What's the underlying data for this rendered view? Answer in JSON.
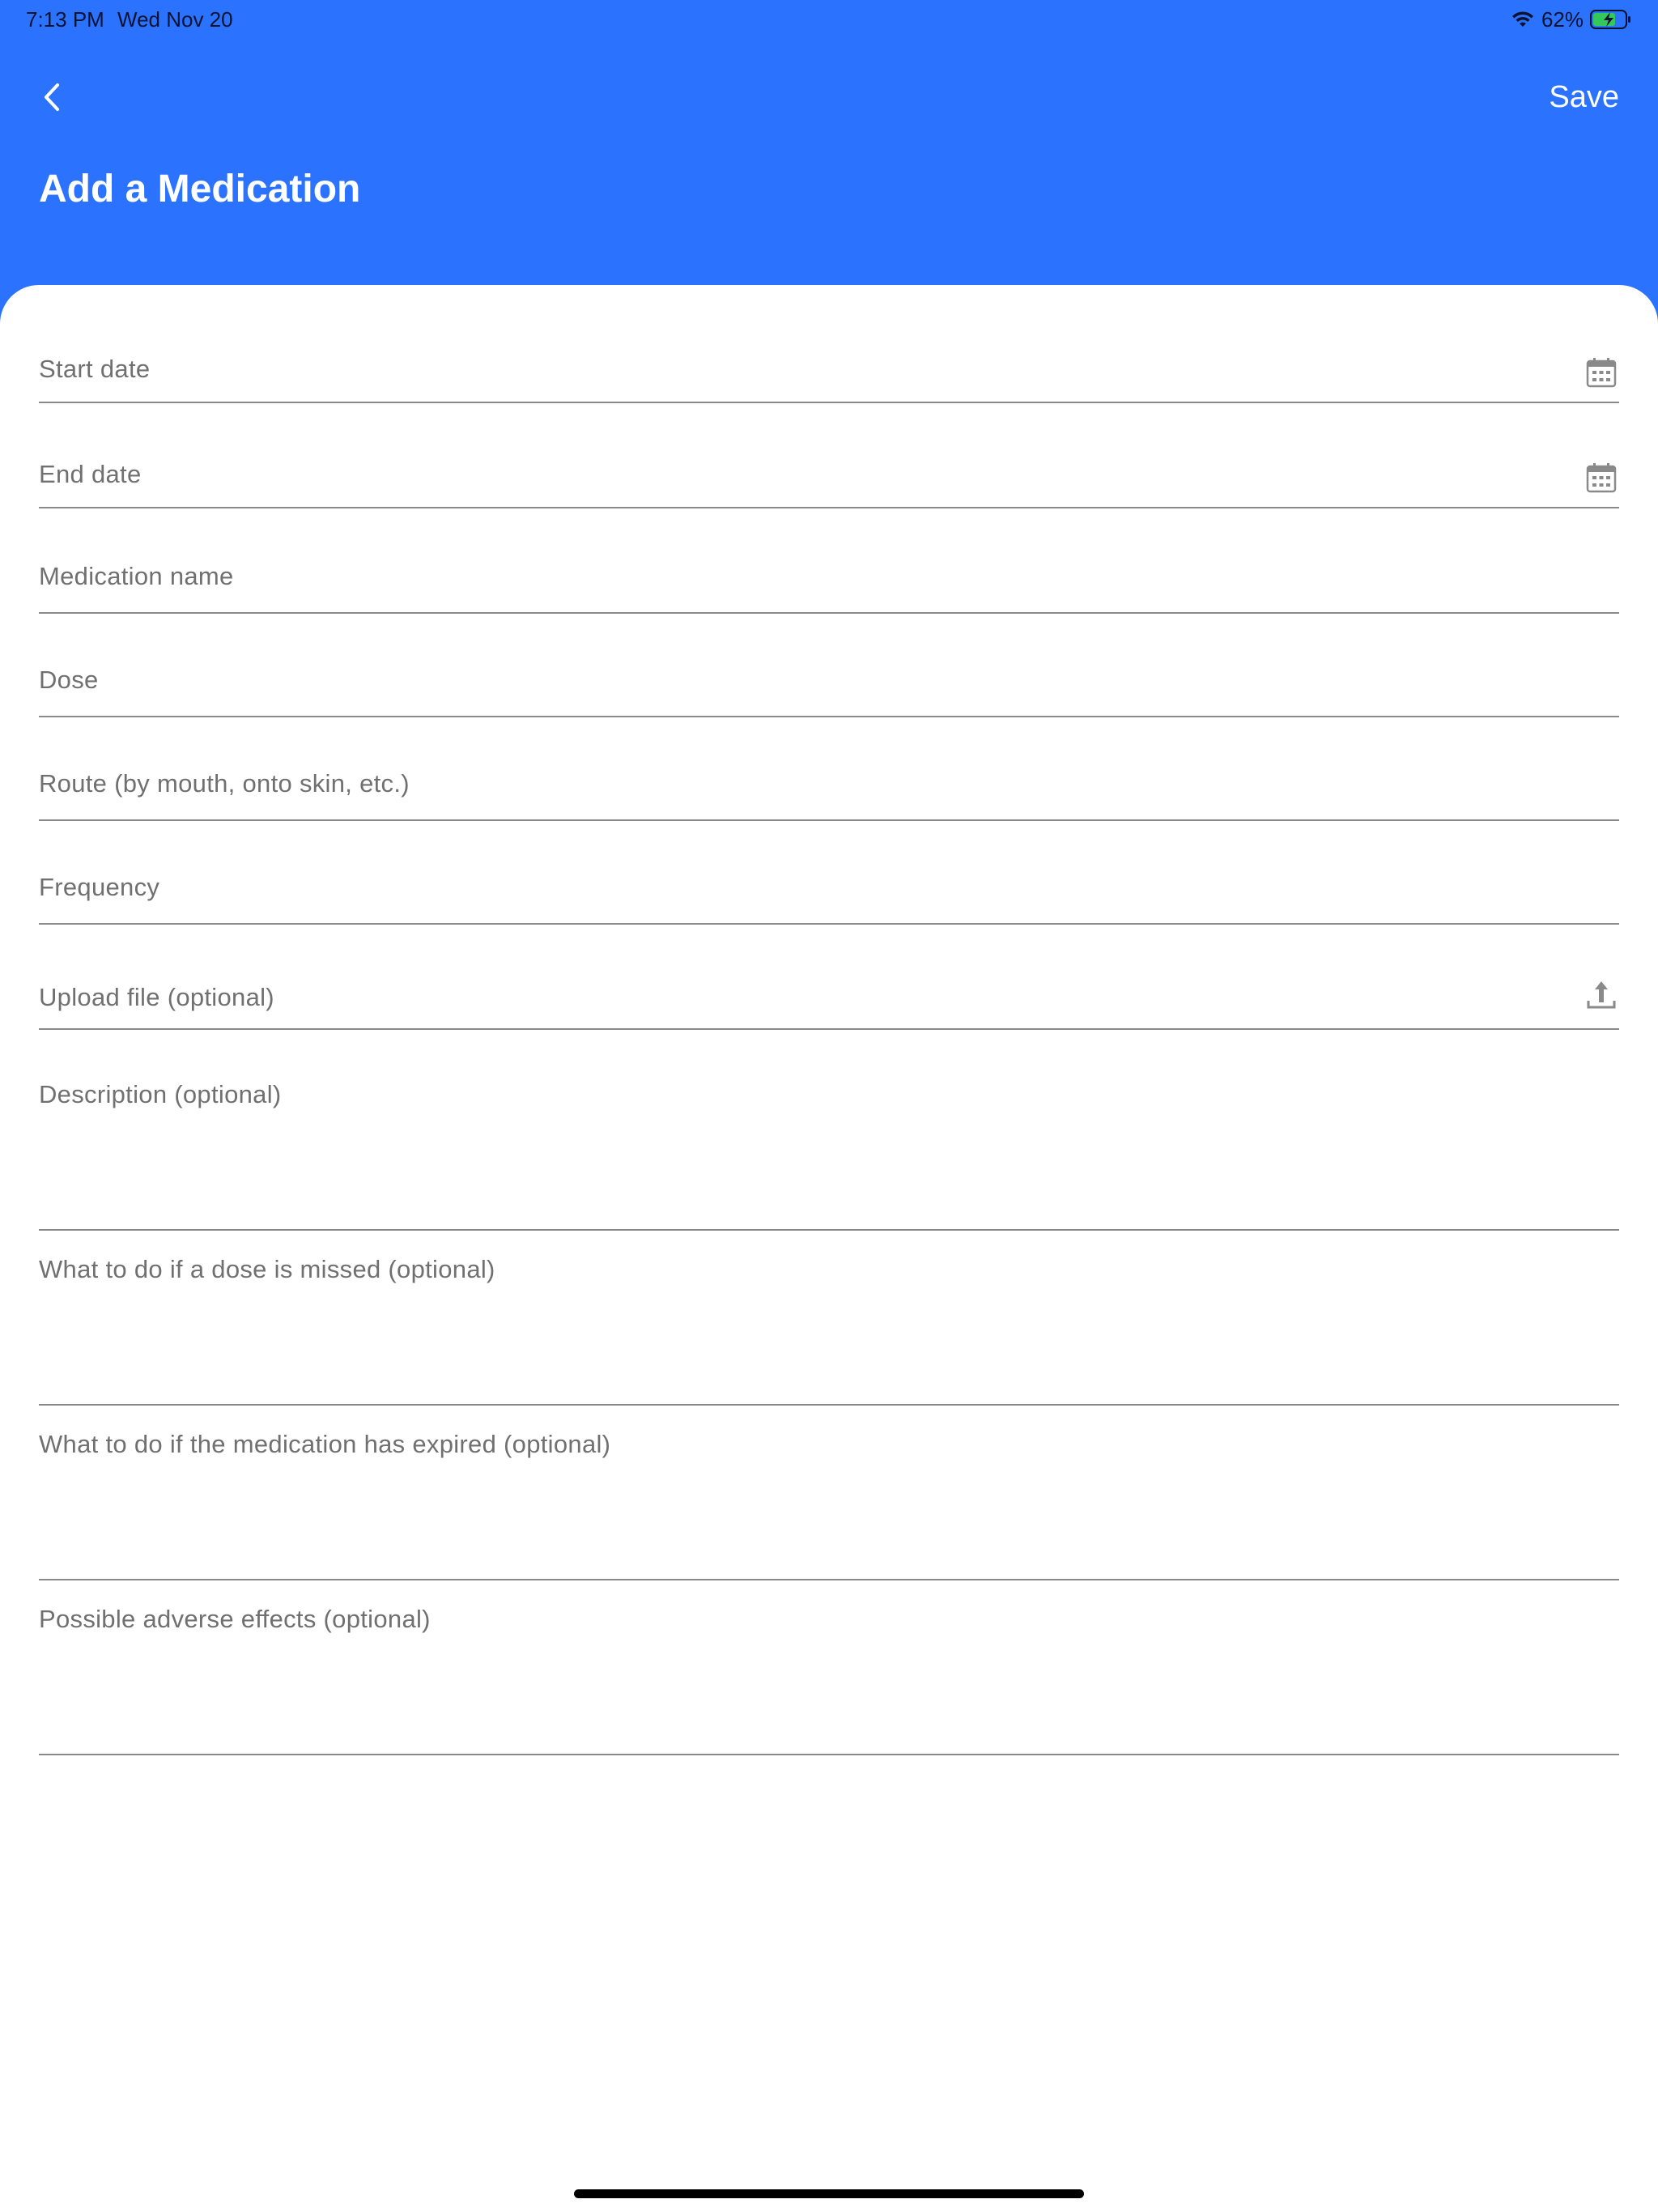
{
  "status_bar": {
    "time": "7:13 PM",
    "date": "Wed Nov 20",
    "battery": "62%"
  },
  "header": {
    "back_icon": "chevron-left-icon",
    "save_label": "Save",
    "title": "Add a Medication",
    "background_color": "#2b73fe"
  },
  "form": {
    "fields": [
      {
        "label": "Start date",
        "icon": "calendar-icon"
      },
      {
        "label": "End date",
        "icon": "calendar-icon"
      },
      {
        "label": "Medication name"
      },
      {
        "label": "Dose"
      },
      {
        "label": "Route (by mouth, onto skin, etc.)"
      },
      {
        "label": "Frequency"
      },
      {
        "label": "Upload file (optional)",
        "icon": "upload-icon"
      },
      {
        "label": "Description (optional)"
      },
      {
        "label": "What to do if a dose is missed (optional)"
      },
      {
        "label": "What to do if the medication has expired (optional)"
      },
      {
        "label": "Possible adverse effects (optional)"
      }
    ]
  }
}
